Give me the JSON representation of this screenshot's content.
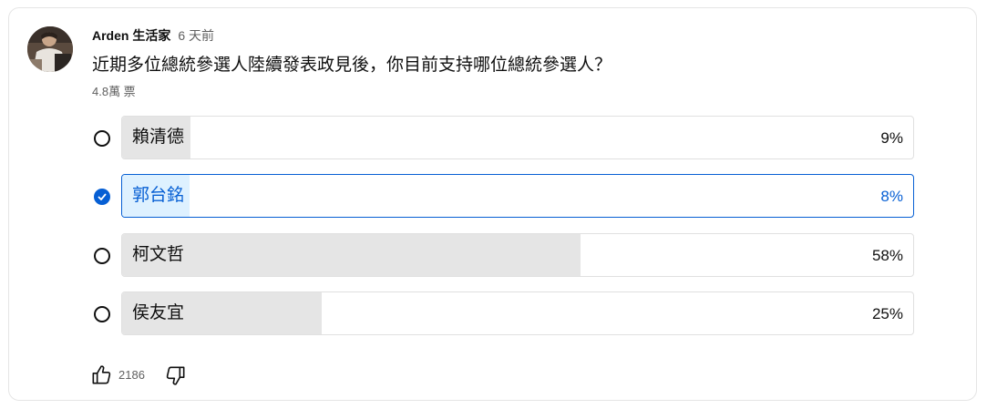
{
  "post": {
    "author": "Arden 生活家",
    "time": "6 天前",
    "question": "近期多位總統參選人陸續發表政見後，你目前支持哪位總統參選人？",
    "votes": "4.8萬 票"
  },
  "options": [
    {
      "label": "賴清德",
      "percent": "9%",
      "fill_fraction": 0.086,
      "selected": false
    },
    {
      "label": "郭台銘",
      "percent": "8%",
      "fill_fraction": 0.085,
      "selected": true
    },
    {
      "label": "柯文哲",
      "percent": "58%",
      "fill_fraction": 0.58,
      "selected": false
    },
    {
      "label": "侯友宜",
      "percent": "25%",
      "fill_fraction": 0.252,
      "selected": false
    }
  ],
  "actions": {
    "like_count": "2186",
    "like_icon": "thumbs-up-icon",
    "dislike_icon": "thumbs-down-icon"
  },
  "colors": {
    "accent": "#065fd4",
    "selected_fill": "#def1ff",
    "bar_fill": "#e5e5e5"
  }
}
